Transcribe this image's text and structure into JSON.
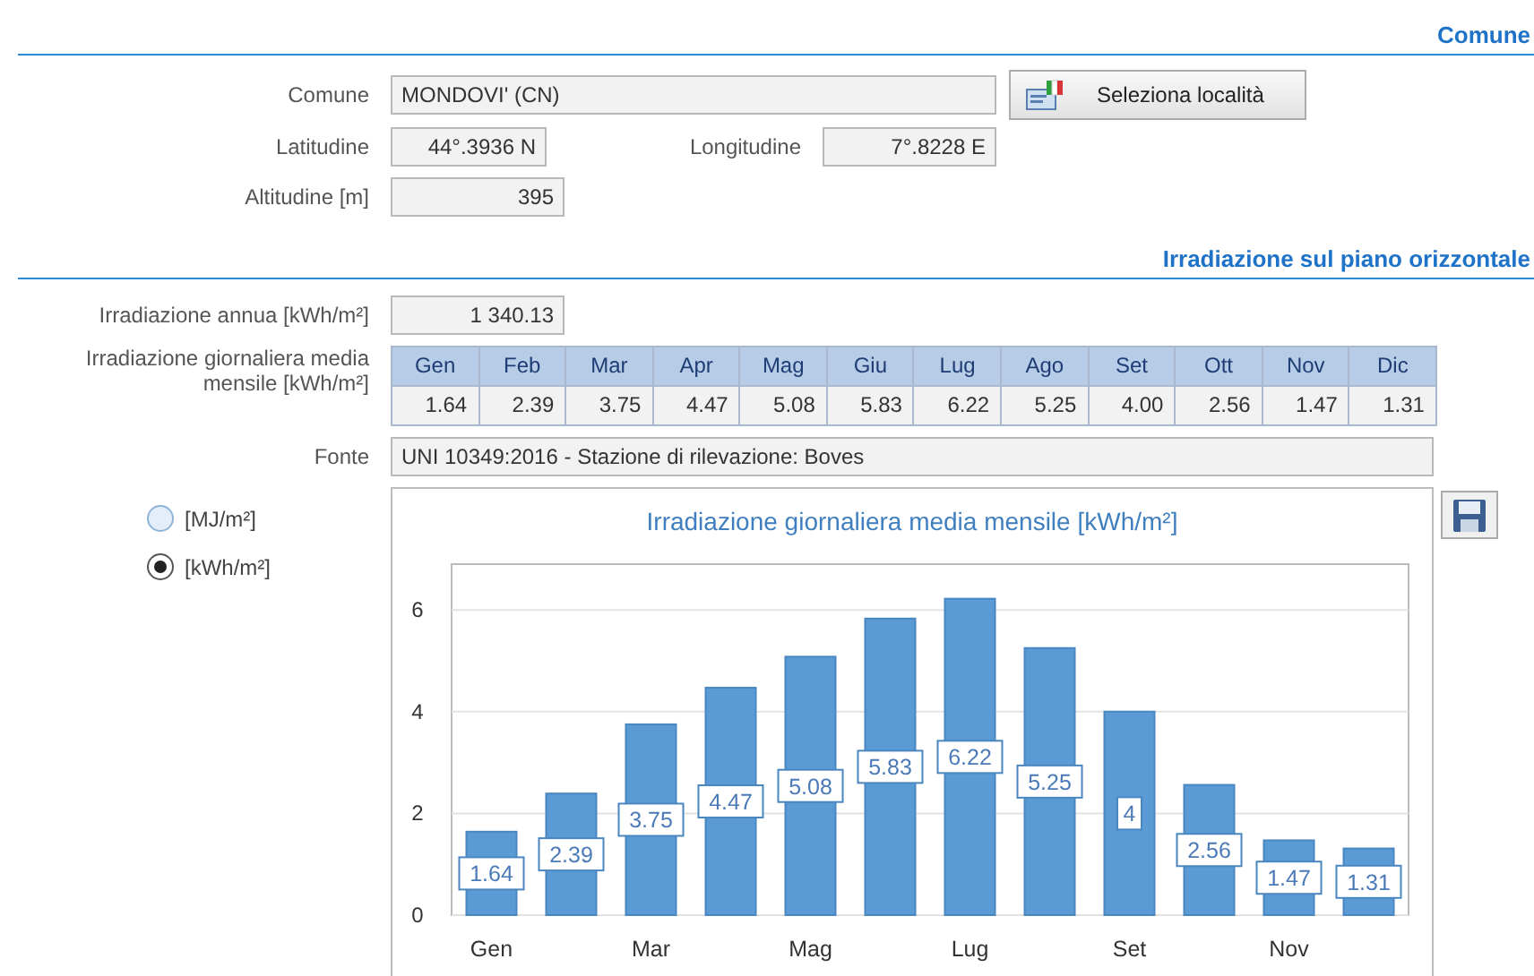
{
  "sections": [
    {
      "title": "Comune"
    },
    {
      "title": "Irradiazione sul piano orizzontale"
    }
  ],
  "location": {
    "comune_label": "Comune",
    "comune_value": "MONDOVI' (CN)",
    "select_button": "Seleziona località",
    "latitude_label": "Latitudine",
    "latitude_value": "44°.3936 N",
    "longitude_label": "Longitudine",
    "longitude_value": "7°.8228 E",
    "altitude_label": "Altitudine [m]",
    "altitude_value": "395"
  },
  "irradiation": {
    "annual_label": "Irradiazione annua [kWh/m²]",
    "annual_value": "1 340.13",
    "monthly_label": "Irradiazione giornaliera media mensile [kWh/m²]",
    "months": [
      {
        "month": "Gen",
        "value": "1.64"
      },
      {
        "month": "Feb",
        "value": "2.39"
      },
      {
        "month": "Mar",
        "value": "3.75"
      },
      {
        "month": "Apr",
        "value": "4.47"
      },
      {
        "month": "Mag",
        "value": "5.08"
      },
      {
        "month": "Giu",
        "value": "5.83"
      },
      {
        "month": "Lug",
        "value": "6.22"
      },
      {
        "month": "Ago",
        "value": "5.25"
      },
      {
        "month": "Set",
        "value": "4.00"
      },
      {
        "month": "Ott",
        "value": "2.56"
      },
      {
        "month": "Nov",
        "value": "1.47"
      },
      {
        "month": "Dic",
        "value": "1.31"
      }
    ],
    "source_label": "Fonte",
    "source_value": "UNI 10349:2016 - Stazione di rilevazione: Boves"
  },
  "units": [
    {
      "label": "[MJ/m²]",
      "selected": false
    },
    {
      "label": "[kWh/m²]",
      "selected": true
    }
  ],
  "chart": {
    "chart_data": {
      "type": "bar",
      "title": "Irradiazione giornaliera media mensile [kWh/m²]",
      "categories": [
        "Gen",
        null,
        "Mar",
        null,
        "Mag",
        null,
        "Lug",
        null,
        "Set",
        null,
        "Nov",
        null
      ],
      "values": [
        1.64,
        2.39,
        3.75,
        4.47,
        5.08,
        5.83,
        6.22,
        5.25,
        4,
        2.56,
        1.47,
        1.31
      ],
      "ylim": [
        0,
        6.9
      ],
      "yticks": [
        0,
        2,
        4,
        6
      ],
      "grid": true,
      "value_labels": [
        "1.64",
        "2.39",
        "3.75",
        "4.47",
        "5.08",
        "5.83",
        "6.22",
        "5.25",
        "4",
        "2.56",
        "1.47",
        "1.31"
      ]
    }
  }
}
